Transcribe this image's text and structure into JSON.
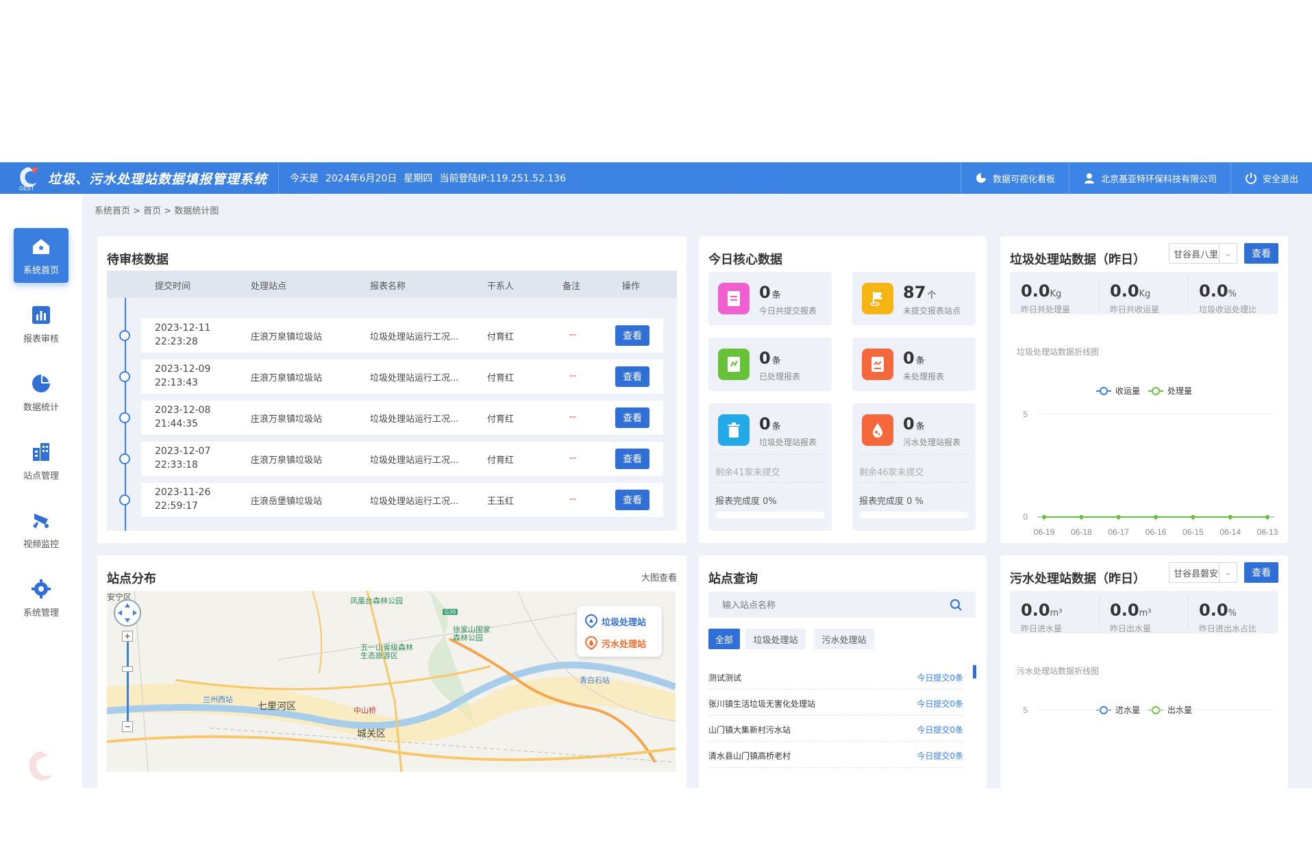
{
  "header": {
    "title": "垃圾、污水处理站数据填报管理系统",
    "today_label": "今天是",
    "date": "2024年6月20日",
    "weekday": "星期四",
    "ip": "当前登陆IP:119.251.52.136",
    "dashboard_label": "数据可视化看板",
    "company": "北京基亚特环保科技有限公司",
    "logout_label": "安全退出"
  },
  "sidebar": {
    "items": [
      {
        "label": "系统首页",
        "icon": "home-icon"
      },
      {
        "label": "报表审核",
        "icon": "bar-chart-icon"
      },
      {
        "label": "数据统计",
        "icon": "pie-chart-icon"
      },
      {
        "label": "站点管理",
        "icon": "building-icon"
      },
      {
        "label": "视频监控",
        "icon": "camera-icon"
      },
      {
        "label": "系统管理",
        "icon": "gear-icon"
      }
    ]
  },
  "breadcrumb": "系统首页 > 首页 > 数据统计图",
  "pending": {
    "title": "待审核数据",
    "columns": [
      "提交时间",
      "处理站点",
      "报表名称",
      "干系人",
      "备注",
      "操作"
    ],
    "rows": [
      {
        "date": "2023-12-11",
        "time": "22:23:28",
        "station": "庄浪万泉镇垃圾站",
        "report": "垃圾处理站运行工况...",
        "person": "付育红",
        "note": "--",
        "action": "查看"
      },
      {
        "date": "2023-12-09",
        "time": "22:13:43",
        "station": "庄浪万泉镇垃圾站",
        "report": "垃圾处理站运行工况...",
        "person": "付育红",
        "note": "--",
        "action": "查看"
      },
      {
        "date": "2023-12-08",
        "time": "21:44:35",
        "station": "庄浪万泉镇垃圾站",
        "report": "垃圾处理站运行工况...",
        "person": "付育红",
        "note": "--",
        "action": "查看"
      },
      {
        "date": "2023-12-07",
        "time": "22:33:18",
        "station": "庄浪万泉镇垃圾站",
        "report": "垃圾处理站运行工况...",
        "person": "付育红",
        "note": "--",
        "action": "查看"
      },
      {
        "date": "2023-11-26",
        "time": "22:59:17",
        "station": "庄浪岳堡镇垃圾站",
        "report": "垃圾处理站运行工况...",
        "person": "王玉红",
        "note": "--",
        "action": "查看"
      }
    ]
  },
  "core": {
    "title": "今日核心数据",
    "cards": [
      {
        "value": "0",
        "unit": "条",
        "label": "今日共提交报表",
        "color": "#f05fd0"
      },
      {
        "value": "87",
        "unit": "个",
        "label": "未提交报表站点",
        "color": "#f7b514"
      },
      {
        "value": "0",
        "unit": "条",
        "label": "已处理报表",
        "color": "#67c23a"
      },
      {
        "value": "0",
        "unit": "条",
        "label": "未处理报表",
        "color": "#f5683c"
      },
      {
        "value": "0",
        "unit": "条",
        "label": "垃圾处理站报表",
        "color": "#23a9e8",
        "remain": "剩余41家未提交",
        "progress": "报表完成度 0%"
      },
      {
        "value": "0",
        "unit": "条",
        "label": "污水处理站报表",
        "color": "#f5683c",
        "remain": "剩余46家未提交",
        "progress": "报表完成度 0 %"
      }
    ]
  },
  "garbage": {
    "title": "垃圾处理站数据（昨日）",
    "select": "甘谷县八里",
    "button": "查看",
    "stats": [
      {
        "value": "0.0",
        "unit": "Kg",
        "label": "昨日共处理量"
      },
      {
        "value": "0.0",
        "unit": "Kg",
        "label": "昨日共收运量"
      },
      {
        "value": "0.0",
        "unit": "%",
        "label": "垃圾收运处理比"
      }
    ],
    "chart_title": "垃圾处理站数据折线图"
  },
  "map": {
    "title": "站点分布",
    "big_view": "大图查看",
    "legend_garbage": "垃圾处理站",
    "legend_sewage": "污水处理站",
    "labels": [
      "安宁区",
      "凤凰台森林公园",
      "徐家山国家",
      "森林公园",
      "五一山省级森林",
      "生态旅游区",
      "兰州西站",
      "七里河区",
      "中山桥",
      "城关区",
      "青白石站",
      "G30"
    ]
  },
  "query": {
    "title": "站点查询",
    "placeholder": "输入站点名称",
    "tabs": [
      "全部",
      "垃圾处理站",
      "污水处理站"
    ],
    "items": [
      {
        "name": "测试测试",
        "count": "今日提交0条"
      },
      {
        "name": "张川镇生活垃圾无害化处理站",
        "count": "今日提交0条"
      },
      {
        "name": "山门镇大集新村污水站",
        "count": "今日提交0条"
      },
      {
        "name": "清水县山门镇高桥老村",
        "count": "今日提交0条"
      }
    ]
  },
  "sewage": {
    "title": "污水处理站数据（昨日）",
    "select": "甘谷县磐安",
    "button": "查看",
    "stats": [
      {
        "value": "0.0",
        "unit": "m³",
        "label": "昨日进水量"
      },
      {
        "value": "0.0",
        "unit": "m³",
        "label": "昨日出水量"
      },
      {
        "value": "0.0",
        "unit": "%",
        "label": "昨日进出水占比"
      }
    ],
    "chart_title": "污水处理站数据折线图"
  },
  "chart_data": [
    {
      "type": "line",
      "title": "垃圾处理站数据折线图",
      "categories": [
        "06-19",
        "06-18",
        "06-17",
        "06-16",
        "06-15",
        "06-14",
        "06-13"
      ],
      "series": [
        {
          "name": "收运量",
          "values": [
            0,
            0,
            0,
            0,
            0,
            0,
            0
          ],
          "color": "#3a7fe0"
        },
        {
          "name": "处理量",
          "values": [
            0,
            0,
            0,
            0,
            0,
            0,
            0
          ],
          "color": "#67c23a"
        }
      ],
      "y_ticks": [
        "5",
        "0"
      ],
      "ylim": [
        0,
        5
      ],
      "legend": "top-center"
    },
    {
      "type": "line",
      "title": "污水处理站数据折线图",
      "categories": [],
      "series": [
        {
          "name": "进水量",
          "values": [],
          "color": "#3a7fe0"
        },
        {
          "name": "出水量",
          "values": [],
          "color": "#67c23a"
        }
      ],
      "y_ticks": [
        "5"
      ],
      "ylim": [
        0,
        5
      ],
      "legend": "top-center"
    }
  ]
}
